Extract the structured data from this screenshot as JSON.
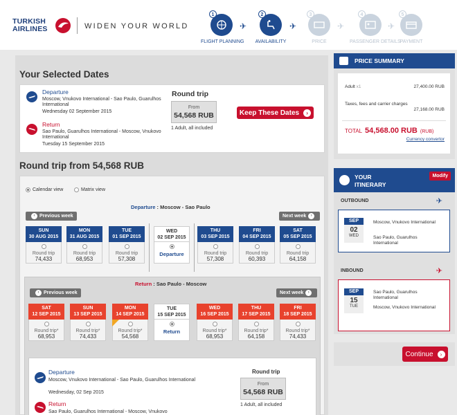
{
  "header": {
    "logo_line1": "TURKISH",
    "logo_line2": "AIRLINES",
    "slogan": "WIDEN YOUR WORLD",
    "steps": [
      {
        "num": "1",
        "label": "FLIGHT PLANNING",
        "icon": "globe-plane-icon",
        "state": "active"
      },
      {
        "num": "2",
        "label": "AVAILABILITY",
        "icon": "seat-icon",
        "state": "active"
      },
      {
        "num": "3",
        "label": "PRICE",
        "icon": "ticket-icon",
        "state": "off"
      },
      {
        "num": "4",
        "label": "PASSENGER DETAILS",
        "icon": "id-card-icon",
        "state": "off"
      },
      {
        "num": "5",
        "label": "PAYMENT",
        "icon": "card-icon",
        "state": "off"
      }
    ]
  },
  "selected": {
    "title": "Your Selected Dates",
    "departure": {
      "label": "Departure",
      "route": "Moscow, Vnukovo International - Sao Paulo, Guarulhos International",
      "date": "Wednesday 02 September 2015"
    },
    "return": {
      "label": "Return",
      "route": "Sao Paulo, Guarulhos International - Moscow, Vnukovo International",
      "date": "Tuesday 15 September 2015"
    },
    "trip_type": "Round trip",
    "from": "From",
    "price": "54,568 RUB",
    "pax": "1 Adult, all included",
    "keep_btn": "Keep These Dates"
  },
  "roundtrip": {
    "title": "Round trip from 54,568 RUB",
    "calendar_view": "Calendar view",
    "matrix_view": "Matrix view",
    "prev_week": "Previous week",
    "next_week": "Next week",
    "departure_label": "Departure",
    "departure_route": "Moscow - Sao Paulo",
    "return_label": "Return",
    "return_route": "Sao Paulo - Moscow",
    "dep_days": [
      {
        "dow": "SUN",
        "date": "30 AUG 2015",
        "type": "Round trip",
        "price": "74,433"
      },
      {
        "dow": "MON",
        "date": "31 AUG 2015",
        "type": "Round trip",
        "price": "68,953"
      },
      {
        "dow": "TUE",
        "date": "01 SEP 2015",
        "type": "Round trip",
        "price": "57,308"
      },
      {
        "dow": "WED",
        "date": "02 SEP 2015",
        "type": "Departure",
        "price": ""
      },
      {
        "dow": "THU",
        "date": "03 SEP 2015",
        "type": "Round trip",
        "price": "57,308"
      },
      {
        "dow": "FRI",
        "date": "04 SEP 2015",
        "type": "Round trip",
        "price": "60,393"
      },
      {
        "dow": "SAT",
        "date": "05 SEP 2015",
        "type": "Round trip",
        "price": "64,158"
      }
    ],
    "ret_days": [
      {
        "dow": "SAT",
        "date": "12 SEP 2015",
        "type": "Round trip*",
        "price": "68,953"
      },
      {
        "dow": "SUN",
        "date": "13 SEP 2015",
        "type": "Round trip*",
        "price": "74,433"
      },
      {
        "dow": "MON",
        "date": "14 SEP 2015",
        "type": "Round trip*",
        "price": "54,568"
      },
      {
        "dow": "TUE",
        "date": "15 SEP 2015",
        "type": "Return",
        "price": ""
      },
      {
        "dow": "WED",
        "date": "16 SEP 2015",
        "type": "Round trip*",
        "price": "68,953"
      },
      {
        "dow": "THU",
        "date": "17 SEP 2015",
        "type": "Round trip*",
        "price": "64,158"
      },
      {
        "dow": "FRI",
        "date": "18 SEP 2015",
        "type": "Round trip*",
        "price": "74,433"
      }
    ],
    "detail": {
      "dep_label": "Departure",
      "dep_route": "Moscow, Vnukovo International - Sao Paulo, Guarulhos International",
      "dep_date": "Wednesday, 02 Sep 2015",
      "ret_label": "Return",
      "ret_route": "Sao Paulo, Guarulhos International - Moscow, Vnukovo",
      "trip_type": "Round trip",
      "from": "From",
      "price": "54,568 RUB",
      "pax": "1 Adult, all included"
    }
  },
  "summary": {
    "title": "PRICE SUMMARY",
    "adult_label": "Adult",
    "adult_mult": "x1",
    "adult_price": "27,400.00 RUB",
    "taxes_label": "Taxes, fees and carrier charges",
    "taxes_price": "27,168.00 RUB",
    "total_label": "TOTAL",
    "total_price": "54,568.00 RUB",
    "total_cur": "(RUB)",
    "converter": "Currency convertor"
  },
  "itinerary": {
    "title1": "YOUR",
    "title2": "ITINERARY",
    "modify": "Modify",
    "outbound": "OUTBOUND",
    "inbound": "INBOUND",
    "out": {
      "month": "SEP",
      "day": "02",
      "dow": "WED",
      "from": "Moscow, Vnukovo International",
      "to": "Sao Paulo, Guarulhos International"
    },
    "in": {
      "month": "SEP",
      "day": "15",
      "dow": "TUE",
      "from": "Sao Paulo, Guarulhos International",
      "to": "Moscow, Vnukovo International"
    }
  },
  "continue_btn": "Continue",
  "colors": {
    "brand_blue": "#1f4b8f",
    "brand_red": "#c8102e",
    "return_red": "#e8422d"
  }
}
